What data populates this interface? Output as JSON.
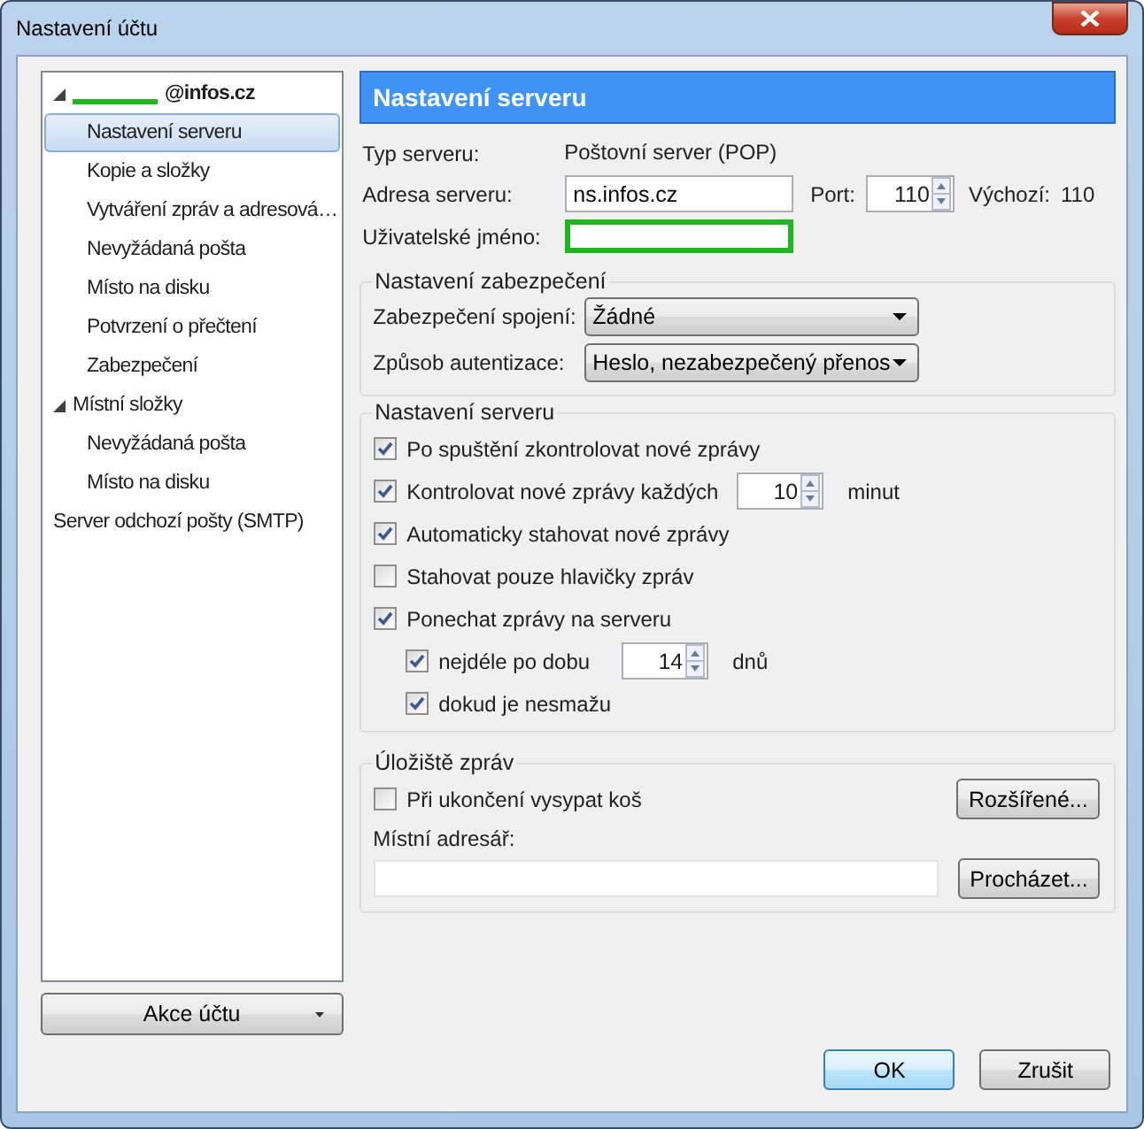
{
  "window": {
    "title": "Nastavení účtu"
  },
  "account_tree": [
    {
      "label": "@infos.cz",
      "kind": "account",
      "expanded": true,
      "selected": false,
      "children": [
        {
          "label": "Nastavení serveru",
          "selected": true
        },
        {
          "label": "Kopie a složky",
          "selected": false
        },
        {
          "label": "Vytváření zpráv a adresová…",
          "selected": false
        },
        {
          "label": "Nevyžádaná pošta",
          "selected": false
        },
        {
          "label": "Místo na disku",
          "selected": false
        },
        {
          "label": "Potvrzení o přečtení",
          "selected": false
        },
        {
          "label": "Zabezpečení",
          "selected": false
        }
      ]
    },
    {
      "label": "Místní složky",
      "kind": "folder",
      "expanded": true,
      "selected": false,
      "children": [
        {
          "label": "Nevyžádaná pošta",
          "selected": false
        },
        {
          "label": "Místo na disku",
          "selected": false
        }
      ]
    },
    {
      "label": "Server odchozí pošty (SMTP)",
      "kind": "folder",
      "selected": false
    }
  ],
  "account_actions": {
    "label": "Akce účtu"
  },
  "panel": {
    "title": "Nastavení serveru",
    "server_type": {
      "label": "Typ serveru:",
      "value": "Poštovní server (POP)"
    },
    "server_address": {
      "label": "Adresa serveru:",
      "value": "ns.infos.cz"
    },
    "port": {
      "label": "Port:",
      "value": "110"
    },
    "default_port": {
      "label": "Výchozí:",
      "value": "110"
    },
    "username": {
      "label": "Uživatelské jméno:"
    }
  },
  "security": {
    "title": "Nastavení zabezpečení",
    "rows": [
      {
        "label": "Zabezpečení spojení:",
        "value": "Žádné"
      },
      {
        "label": "Způsob autentizace:",
        "value": "Heslo, nezabezpečený přenos"
      }
    ]
  },
  "server_settings": {
    "title": "Nastavení serveru",
    "options": [
      {
        "kind": "plain",
        "label": "Po spuštění zkontrolovat nové zprávy",
        "checked": true
      },
      {
        "kind": "spinner",
        "label": "Kontrolovat nové zprávy každých",
        "checked": true,
        "value": "10",
        "unit": "minut"
      },
      {
        "kind": "plain",
        "label": "Automaticky stahovat nové zprávy",
        "checked": true
      },
      {
        "kind": "plain",
        "label": "Stahovat pouze hlavičky zpráv",
        "checked": false
      },
      {
        "kind": "plain",
        "label": "Ponechat zprávy na serveru",
        "checked": true,
        "children": [
          {
            "kind": "spinner",
            "label": "nejdéle po dobu",
            "checked": true,
            "value": "14",
            "unit": "dnů"
          },
          {
            "kind": "plain",
            "label": "dokud je nesmažu",
            "checked": true
          }
        ]
      }
    ]
  },
  "storage": {
    "title": "Úložiště zpráv",
    "empty_trash": {
      "label": "Při ukončení vysypat koš",
      "checked": false
    },
    "advanced_button": "Rozšířené...",
    "local_dir": {
      "label": "Místní adresář:"
    },
    "browse_button": "Procházet..."
  },
  "buttons": [
    {
      "label": "OK",
      "kind": "default"
    },
    {
      "label": "Zrušit",
      "kind": "normal"
    }
  ]
}
